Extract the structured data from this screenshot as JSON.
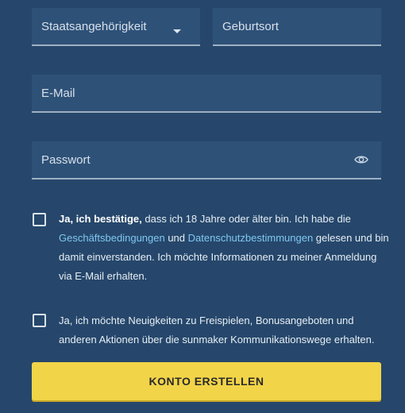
{
  "form": {
    "nationality": {
      "placeholder": "Staatsangehörigkeit"
    },
    "birthplace": {
      "placeholder": "Geburtsort"
    },
    "email": {
      "placeholder": "E-Mail"
    },
    "password": {
      "placeholder": "Passwort"
    }
  },
  "consent": {
    "checked": false,
    "bold": "Ja, ich bestätige,",
    "part1": " dass ich 18 Jahre oder älter bin. Ich habe die ",
    "terms_link": "Geschäftsbedingungen",
    "part2": " und ",
    "privacy_link": "Datenschutzbestimmungen",
    "part3": " gelesen und bin damit einverstanden. Ich möchte Informationen zu meiner Anmeldung via E-Mail erhalten."
  },
  "newsletter": {
    "checked": false,
    "text": "Ja, ich möchte Neuigkeiten zu Freispielen, Bonusangeboten und anderen Aktionen über die sunmaker Kommunikationswege erhalten."
  },
  "submit_label": "KONTO ERSTELLEN",
  "colors": {
    "background": "#26476b",
    "field": "#2e5178",
    "link": "#7fc7f2",
    "cta": "#f2d448"
  },
  "icons": {
    "select_arrow": "chevron-down-icon",
    "password_toggle": "eye-icon"
  }
}
